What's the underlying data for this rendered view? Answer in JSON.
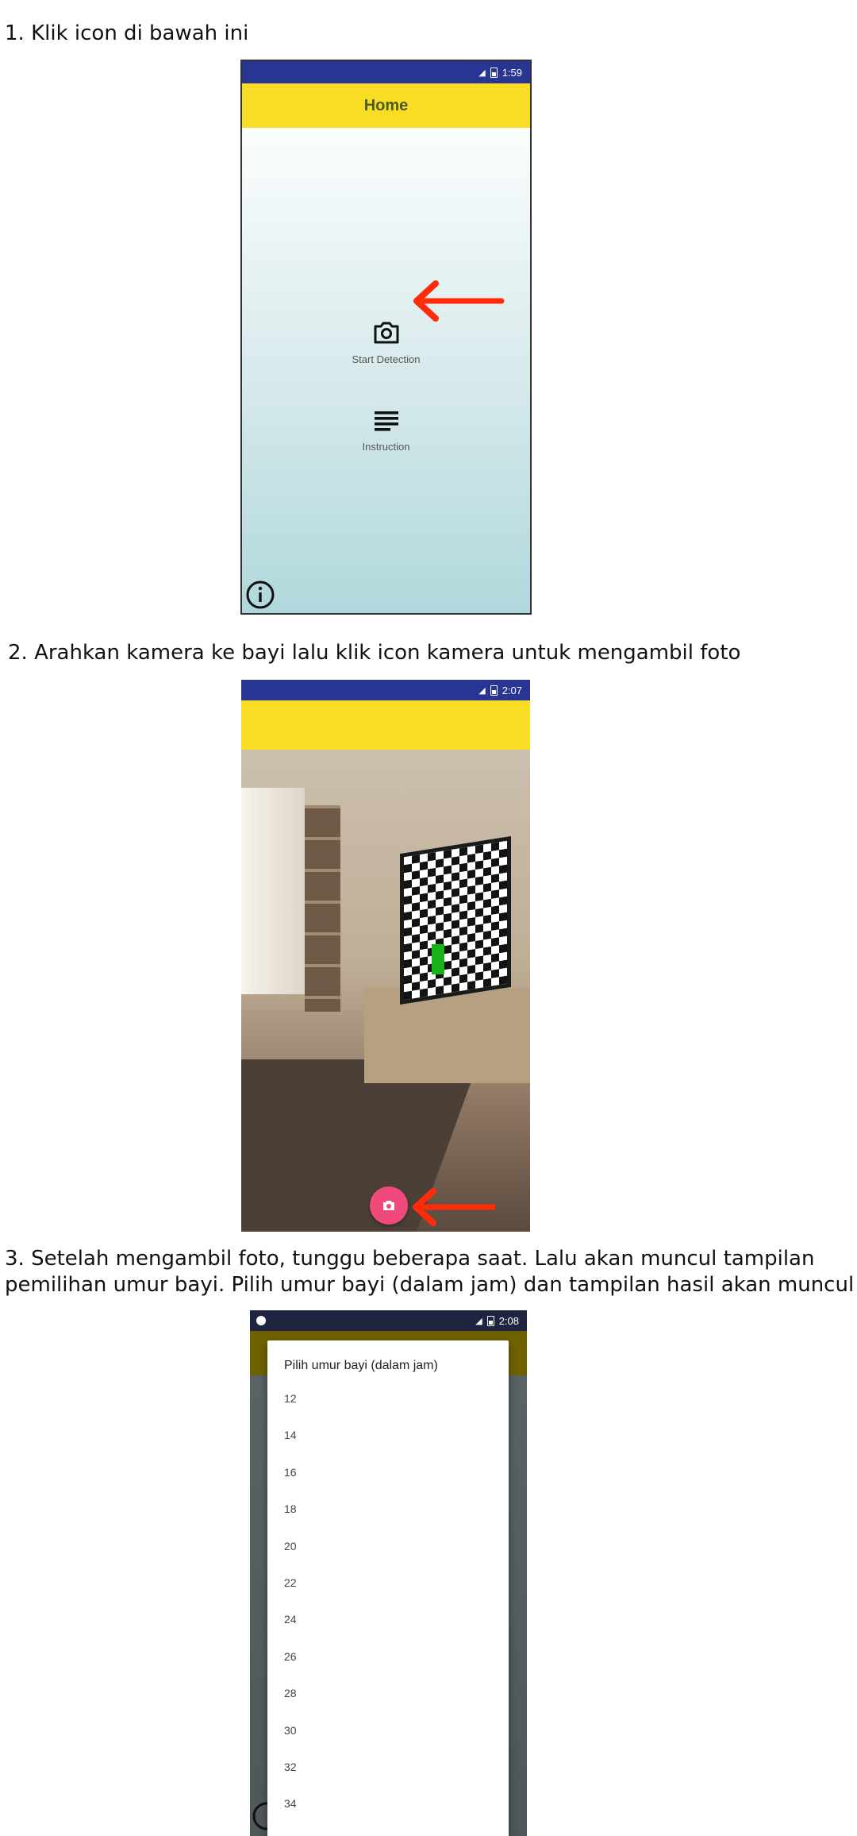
{
  "steps": [
    {
      "text": "1. Klik icon di bawah ini"
    },
    {
      "text": "2. Arahkan kamera ke bayi lalu klik icon kamera untuk mengambil foto"
    },
    {
      "line1": "3. Setelah mengambil foto, tunggu beberapa saat. Lalu akan muncul tampilan",
      "line2": "pemilihan umur bayi. Pilih umur bayi (dalam jam) dan tampilan hasil akan muncul"
    }
  ],
  "phone1": {
    "status_time": "1:59",
    "appbar_title": "Home",
    "actions": [
      {
        "label": "Start Detection",
        "icon": "camera-icon"
      },
      {
        "label": "Instruction",
        "icon": "list-icon"
      }
    ],
    "info_icon": "info-icon"
  },
  "phone2": {
    "status_time": "2:07",
    "capture_icon": "camera-icon"
  },
  "phone3": {
    "status_time": "2:08",
    "dialog_title": "Pilih umur bayi (dalam jam)",
    "options": [
      "12",
      "14",
      "16",
      "18",
      "20",
      "22",
      "24",
      "26",
      "28",
      "30",
      "32",
      "34"
    ]
  },
  "colors": {
    "status_bar": "#283593",
    "app_bar": "#f9dc24",
    "arrow": "#ff2b0a",
    "capture_button": "#ef4a7b",
    "dim_app_bar": "#6f6100"
  }
}
